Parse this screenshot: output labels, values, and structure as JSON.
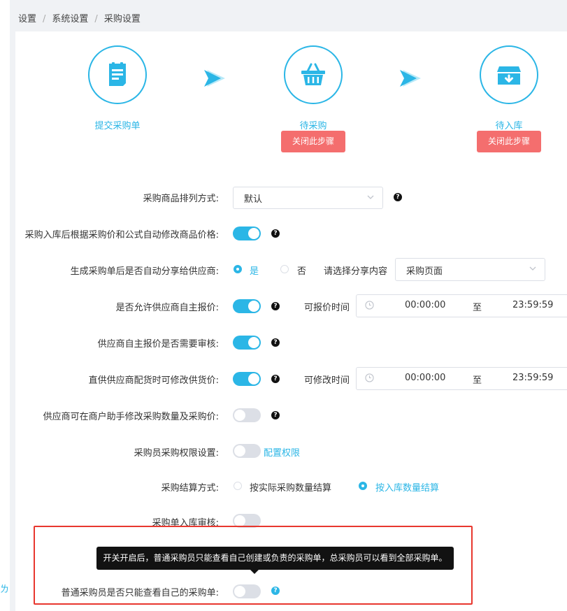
{
  "breadcrumb": [
    "设置",
    "系统设置",
    "采购设置"
  ],
  "breadcrumb_separator": "/",
  "left_edge_glyph": "ㄌ",
  "steps": [
    {
      "label": "提交采购单",
      "icon": "document-icon"
    },
    {
      "label": "待采购",
      "icon": "basket-icon",
      "close_button": "关闭此步骤"
    },
    {
      "label": "待入库",
      "icon": "inbox-icon",
      "close_button": "关闭此步骤"
    }
  ],
  "settings": {
    "sort": {
      "label": "采购商品排列方式:",
      "value": "默认"
    },
    "auto_price": {
      "label": "采购入库后根据采购价和公式自动修改商品价格:",
      "on": true
    },
    "auto_share": {
      "label": "生成采购单后是否自动分享给供应商:",
      "options": [
        "是",
        "否"
      ],
      "selected": "是",
      "content_label": "请选择分享内容",
      "content_value": "采购页面"
    },
    "self_quote": {
      "label": "是否允许供应商自主报价:",
      "on": true,
      "time_label": "可报价时间",
      "start": "00:00:00",
      "to": "至",
      "end": "23:59:59"
    },
    "quote_review": {
      "label": "供应商自主报价是否需要审核:",
      "on": true
    },
    "direct_supply": {
      "label": "直供供应商配货时可修改供货价:",
      "on": true,
      "time_label": "可修改时间",
      "start": "00:00:00",
      "to": "至",
      "end": "23:59:59"
    },
    "assistant_edit": {
      "label": "供应商可在商户助手修改采购数量及采购价:",
      "on": false
    },
    "permission": {
      "label": "采购员采购权限设置:",
      "on": false,
      "link": "配置权限"
    },
    "settlement": {
      "label": "采购结算方式:",
      "options": [
        "按实际采购数量结算",
        "按入库数量结算"
      ],
      "selected": "按入库数量结算"
    },
    "inbound_review": {
      "label": "采购单入库审核:",
      "on": false
    },
    "own_only": {
      "label": "普通采购员是否只能查看自己的采购单:",
      "on": false,
      "tooltip": "开关开启后，普通采购员只能查看自己创建或负责的采购单，总采购员可以看到全部采购单。"
    }
  },
  "colors": {
    "accent": "#2bb6e6",
    "danger_button": "#f46e6e",
    "highlight_box": "#e8372e"
  }
}
